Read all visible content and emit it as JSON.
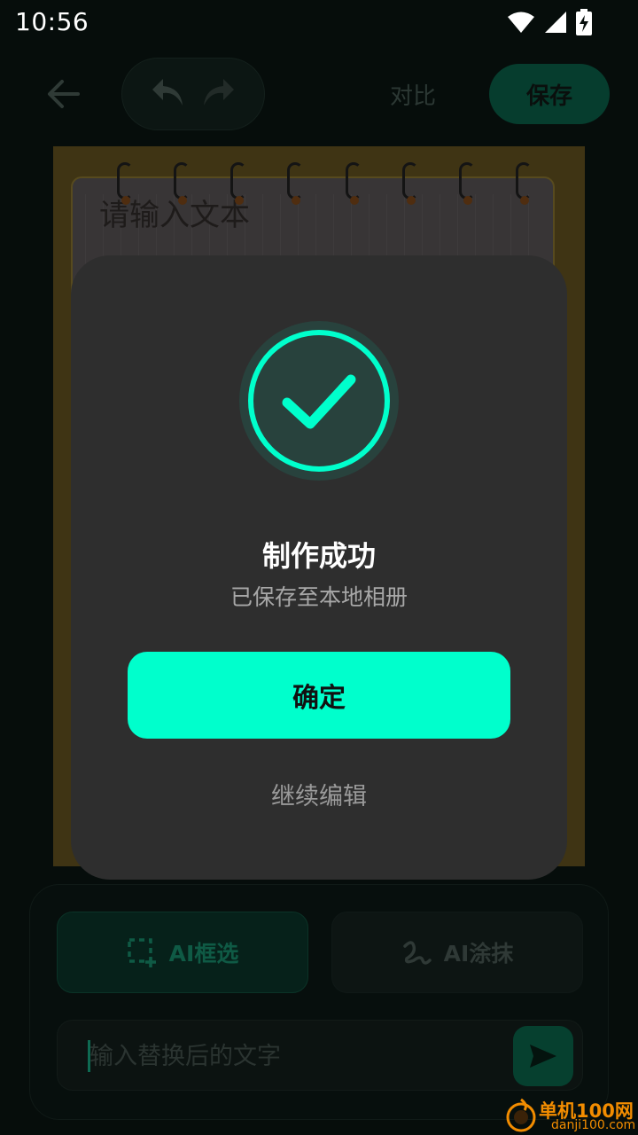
{
  "status_bar": {
    "time": "10:56",
    "icons": [
      "wifi-icon",
      "signal-icon",
      "battery-charging-icon"
    ]
  },
  "toolbar": {
    "back_icon": "arrow-left-icon",
    "undo_icon": "undo-icon",
    "redo_icon": "redo-icon",
    "compare_label": "对比",
    "save_label": "保存"
  },
  "canvas": {
    "placeholder_text": "请输入文本"
  },
  "dialog": {
    "icon": "check-circle-icon",
    "title": "制作成功",
    "subtitle": "已保存至本地相册",
    "confirm_label": "确定",
    "continue_label": "继续编辑"
  },
  "bottom_panel": {
    "tools": [
      {
        "label": "AI框选",
        "icon": "dashed-select-icon",
        "active": true
      },
      {
        "label": "AI涂抹",
        "icon": "scribble-icon",
        "active": false
      }
    ],
    "input_placeholder": "输入替换后的文字",
    "send_icon": "send-icon"
  },
  "watermark": {
    "name": "单机100网",
    "url": "danji100.com"
  },
  "colors": {
    "accent": "#00ffcc",
    "dialog_bg": "#2e2e2e",
    "page_bg": "#060d0b",
    "watermark": "#f28c00"
  }
}
